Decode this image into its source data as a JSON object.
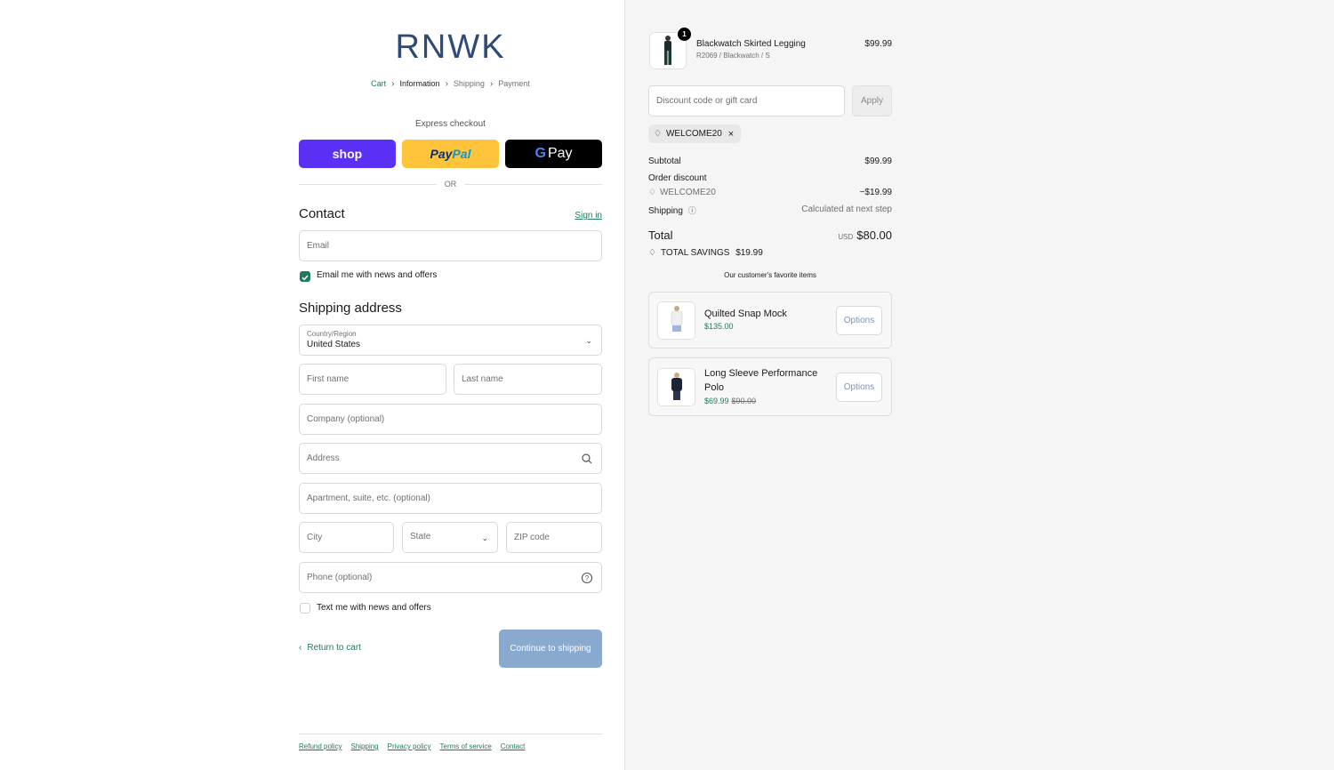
{
  "brand": {
    "logo_text": "RNWK"
  },
  "breadcrumbs": [
    {
      "label": "Cart"
    },
    {
      "label": "Information"
    },
    {
      "label": "Shipping"
    },
    {
      "label": "Payment"
    }
  ],
  "express": {
    "label": "Express checkout",
    "shop_label": "shop",
    "paypal_label_a": "Pay",
    "paypal_label_b": "Pal",
    "gpay_g": "G",
    "gpay_label": "Pay",
    "or_label": "OR"
  },
  "contact": {
    "title": "Contact",
    "sign_in": "Sign in",
    "email_placeholder": "Email",
    "news_label": "Email me with news and offers",
    "news_checked": true
  },
  "shipping": {
    "title": "Shipping address",
    "country_label": "Country/Region",
    "country_value": "United States",
    "first_name": "First name",
    "last_name": "Last name",
    "company": "Company (optional)",
    "address": "Address",
    "apartment": "Apartment, suite, etc. (optional)",
    "city": "City",
    "state": "State",
    "zip": "ZIP code",
    "phone": "Phone (optional)",
    "text_label": "Text me with news and offers",
    "text_checked": false
  },
  "actions": {
    "return_label": "Return to cart",
    "continue_label": "Continue to shipping"
  },
  "footer": {
    "links": [
      "Refund policy",
      "Shipping",
      "Privacy policy",
      "Terms of service",
      "Contact"
    ]
  },
  "order": {
    "item": {
      "quantity": "1",
      "name": "Blackwatch Skirted Legging",
      "variant": "R2069 / Blackwatch / S",
      "price": "$99.99"
    },
    "discount_placeholder": "Discount code or gift card",
    "apply_label": "Apply",
    "applied_code": "WELCOME20",
    "subtotal_label": "Subtotal",
    "subtotal_value": "$99.99",
    "order_discount_label": "Order discount",
    "order_discount_code": "WELCOME20",
    "order_discount_value": "−$19.99",
    "shipping_label": "Shipping",
    "shipping_value": "Calculated at next step",
    "total_label": "Total",
    "total_currency": "USD",
    "total_value": "$80.00",
    "savings_label": "TOTAL SAVINGS",
    "savings_value": "$19.99"
  },
  "favorites": {
    "title": "Our customer's favorite items",
    "items": [
      {
        "name": "Quilted Snap Mock",
        "price": "$135.00",
        "compare": "",
        "button": "Options"
      },
      {
        "name": "Long Sleeve Performance Polo",
        "price": "$69.99",
        "compare": "$90.00",
        "button": "Options"
      }
    ]
  },
  "colors": {
    "accent": "#1f7a5f",
    "shop_pay": "#5a31f4",
    "paypal": "#ffc439",
    "continue_disabled": "#8aa9cf",
    "logo": "#2e4a78"
  }
}
